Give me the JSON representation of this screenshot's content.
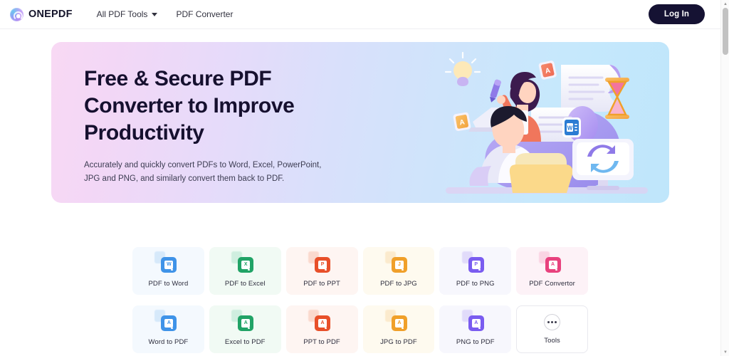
{
  "navbar": {
    "brand": "ONEPDF",
    "brand_icon": "onepdf-spiral-logo-icon",
    "links": [
      {
        "label": "All PDF Tools",
        "has_caret": true
      },
      {
        "label": "PDF Converter",
        "has_caret": false
      }
    ],
    "login_label": "Log In"
  },
  "hero": {
    "title_line1": "Free & Secure PDF",
    "title_line2": "Converter to Improve",
    "title_line3": "Productivity",
    "subtitle_line1": "Accurately and quickly convert PDFs to Word, Excel, PowerPoint,",
    "subtitle_line2": "JPG and PNG, and similarly convert them back to PDF.",
    "illustration": "people-converting-documents-illustration",
    "gradient_from": "#f8d9f4",
    "gradient_to": "#bfe6fb"
  },
  "tools": [
    {
      "label": "PDF to Word",
      "icon": "word-file-icon",
      "icon_color": "#3f93e8",
      "ghost_color": "#9ecbf4",
      "card_bg": "#f4f9fe",
      "glyph": "W"
    },
    {
      "label": "PDF to Excel",
      "icon": "excel-file-icon",
      "icon_color": "#21a366",
      "ghost_color": "#8fd9b8",
      "card_bg": "#f1faf4",
      "glyph": "X"
    },
    {
      "label": "PDF to PPT",
      "icon": "ppt-file-icon",
      "icon_color": "#e8502a",
      "ghost_color": "#f5a58c",
      "card_bg": "#fef5f2",
      "glyph": "P"
    },
    {
      "label": "PDF to JPG",
      "icon": "jpg-file-icon",
      "icon_color": "#f0a02a",
      "ghost_color": "#f8cd8d",
      "card_bg": "#fefaef",
      "glyph": "J"
    },
    {
      "label": "PDF to PNG",
      "icon": "png-file-icon",
      "icon_color": "#7a5cf0",
      "ghost_color": "#b9a8f7",
      "card_bg": "#f7f7fd",
      "glyph": "P"
    },
    {
      "label": "PDF Convertor",
      "icon": "pdf-file-icon",
      "icon_color": "#e8427e",
      "ghost_color": "#f59cbf",
      "card_bg": "#fdf2f7",
      "glyph": "A"
    },
    {
      "label": "Word to PDF",
      "icon": "pdf-from-word-icon",
      "icon_color": "#3f93e8",
      "ghost_color": "#9ecbf4",
      "card_bg": "#f4f9fe",
      "glyph": "A"
    },
    {
      "label": "Excel to PDF",
      "icon": "pdf-from-excel-icon",
      "icon_color": "#21a366",
      "ghost_color": "#8fd9b8",
      "card_bg": "#f1faf4",
      "glyph": "A"
    },
    {
      "label": "PPT to PDF",
      "icon": "pdf-from-ppt-icon",
      "icon_color": "#e8502a",
      "ghost_color": "#f5a58c",
      "card_bg": "#fef5f2",
      "glyph": "A"
    },
    {
      "label": "JPG to PDF",
      "icon": "pdf-from-jpg-icon",
      "icon_color": "#f0a02a",
      "ghost_color": "#f8cd8d",
      "card_bg": "#fefaef",
      "glyph": "A"
    },
    {
      "label": "PNG to PDF",
      "icon": "pdf-from-png-icon",
      "icon_color": "#7a5cf0",
      "ghost_color": "#b9a8f7",
      "card_bg": "#f7f7fd",
      "glyph": "A"
    },
    {
      "label": "Tools",
      "icon": "more-dots-icon",
      "icon_color": "",
      "ghost_color": "",
      "card_bg": "#ffffff",
      "glyph": ""
    }
  ],
  "scrollbar": {
    "up_arrow": "▲",
    "down_arrow": "▼"
  }
}
